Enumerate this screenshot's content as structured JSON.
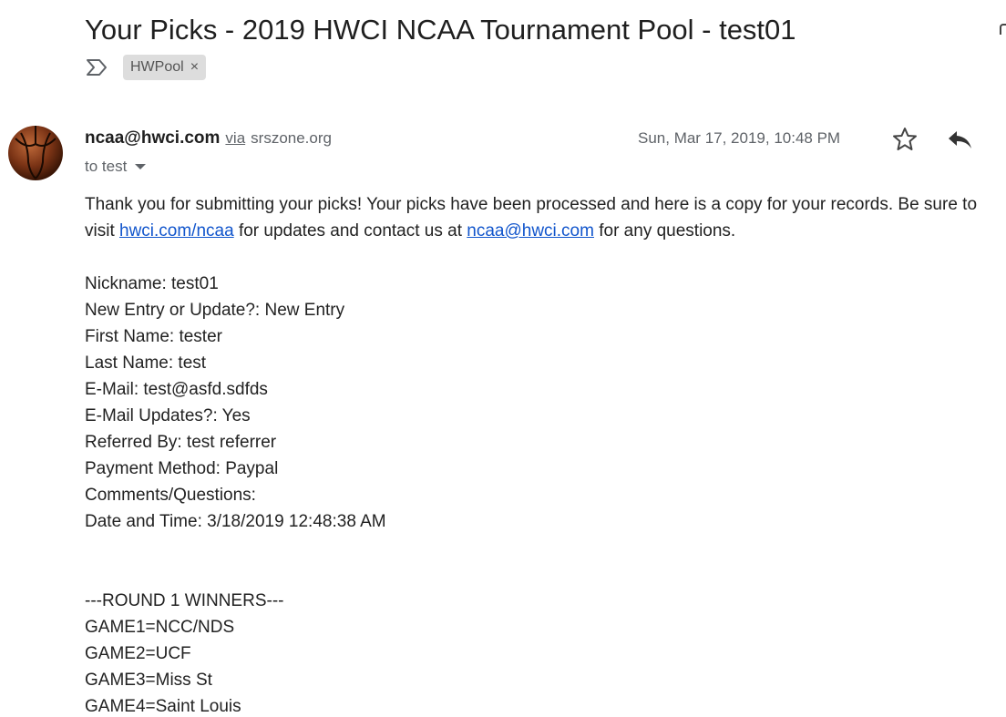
{
  "email": {
    "subject": "Your Picks - 2019 HWCI NCAA Tournament Pool - test01",
    "label": "HWPool",
    "label_remove": "×",
    "sender_email": "ncaa@hwci.com",
    "via_text": "via",
    "via_domain": "srszone.org",
    "recipient_text": "to test",
    "timestamp": "Sun, Mar 17, 2019, 10:48 PM"
  },
  "body": {
    "intro_part1": "Thank you for submitting your picks!  Your picks have been processed and here is a copy for your records. Be sure to visit ",
    "intro_link1": "hwci.com/ncaa",
    "intro_part2": " for updates and contact us at ",
    "intro_link2": "ncaa@hwci.com",
    "intro_part3": " for any questions.",
    "fields": [
      "Nickname: test01",
      "New Entry or Update?: New Entry",
      "First Name: tester",
      "Last Name: test",
      "E-Mail: test@asfd.sdfds",
      "E-Mail Updates?: Yes",
      "Referred By: test referrer",
      "Payment Method: Paypal",
      "Comments/Questions:",
      "Date and Time: 3/18/2019 12:48:38 AM"
    ],
    "round_heading": "---ROUND 1 WINNERS---",
    "games": [
      "GAME1=NCC/NDS",
      "GAME2=UCF",
      "GAME3=Miss St",
      "GAME4=Saint Louis"
    ]
  },
  "icons": {
    "important": "important-marker-icon",
    "label_close": "close-icon",
    "star": "star-outline-icon",
    "reply": "reply-arrow-icon",
    "avatar": "basketball-avatar"
  },
  "colors": {
    "link": "#1155cc",
    "meta_text": "#5f6368",
    "label_chip": "#dddddd"
  }
}
